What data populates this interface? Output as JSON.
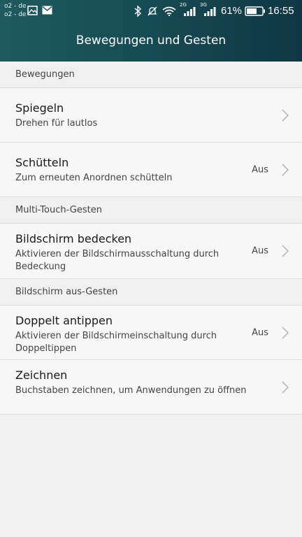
{
  "statusbar": {
    "carrier_1": "o2 - de",
    "carrier_2": "o2 - de",
    "net_1": "2G",
    "net_2": "3G",
    "battery": "61%",
    "time": "16:55"
  },
  "header": {
    "title": "Bewegungen und Gesten"
  },
  "sections": [
    {
      "label": "Bewegungen"
    },
    {
      "label": "Multi-Touch-Gesten"
    },
    {
      "label": "Bildschirm aus-Gesten"
    }
  ],
  "items": [
    {
      "title": "Spiegeln",
      "subtitle": "Drehen für lautlos",
      "status": ""
    },
    {
      "title": "Schütteln",
      "subtitle": "Zum erneuten Anordnen schütteln",
      "status": "Aus"
    },
    {
      "title": "Bildschirm bedecken",
      "subtitle": "Aktivieren der Bildschirmausschaltung durch Bedeckung",
      "status": "Aus"
    },
    {
      "title": "Doppelt antippen",
      "subtitle": "Aktivieren der Bildschirmeinschaltung durch Doppeltippen",
      "status": "Aus"
    },
    {
      "title": "Zeichnen",
      "subtitle": "Buchstaben zeichnen, um Anwendungen zu öffnen",
      "status": ""
    }
  ],
  "colors": {
    "header_start": "#1e5a5f",
    "header_end": "#0f3644",
    "background": "#f2f2f2"
  },
  "icons": [
    "gallery-icon",
    "mail-icon",
    "bluetooth-icon",
    "mute-icon",
    "wifi-icon",
    "signal-icon",
    "battery-icon",
    "chevron-right-icon"
  ]
}
